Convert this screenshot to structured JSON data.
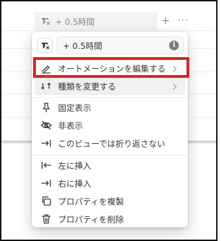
{
  "header": {
    "property_name": "+ 0.5時間",
    "icon": "formula-icon",
    "add_label": "+",
    "more_label": "···"
  },
  "menu": {
    "name_value": "+ 0.5時間",
    "info_label": "i",
    "items": [
      {
        "label": "オートメーションを編集する",
        "icon": "edit-automation-icon"
      },
      {
        "label": "種類を変更する",
        "icon": "change-type-icon"
      },
      {
        "label": "固定表示",
        "icon": "pin-icon"
      },
      {
        "label": "非表示",
        "icon": "eye-off-icon"
      },
      {
        "label": "このビューでは折り返さない",
        "icon": "wrap-icon"
      },
      {
        "label": "左に挿入",
        "icon": "insert-left-icon"
      },
      {
        "label": "右に挿入",
        "icon": "insert-right-icon"
      },
      {
        "label": "プロパティを複製",
        "icon": "duplicate-icon"
      },
      {
        "label": "プロパティを削除",
        "icon": "trash-icon"
      }
    ]
  },
  "colors": {
    "highlight_border": "#e02020",
    "text": "#37352f"
  }
}
